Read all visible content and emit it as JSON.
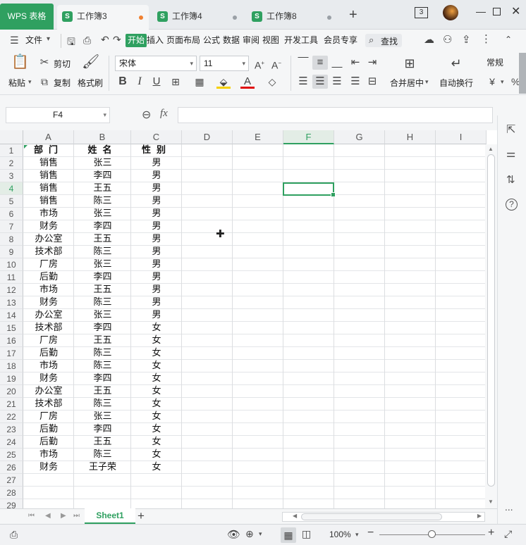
{
  "app": {
    "badge": "WPS 表格"
  },
  "tabs": [
    {
      "label": "工作簿3",
      "active": true,
      "dot_color": "#f08030"
    },
    {
      "label": "工作簿4",
      "active": false,
      "dot_color": "#9aa0a6"
    },
    {
      "label": "工作簿8",
      "active": false,
      "dot_color": "#9aa0a6"
    }
  ],
  "window": {
    "counter": "3"
  },
  "menu": {
    "file": "文件",
    "items": [
      "开始",
      "插入",
      "页面布局",
      "公式",
      "数据",
      "审阅",
      "视图",
      "开发工具",
      "会员专享"
    ],
    "active": "开始",
    "search": "查找"
  },
  "ribbon": {
    "paste": "粘贴",
    "cut": "剪切",
    "copy": "复制",
    "format_painter": "格式刷",
    "font_name": "宋体",
    "font_size": "11",
    "merge_center": "合并居中",
    "auto_wrap": "自动换行",
    "number_format": "常规",
    "currency": "¥"
  },
  "formula_bar": {
    "name_box": "F4",
    "fx": "fx",
    "formula": ""
  },
  "columns": [
    "A",
    "B",
    "C",
    "D",
    "E",
    "F",
    "G",
    "H",
    "I"
  ],
  "selected_column": "F",
  "selected_row": 4,
  "rows": [
    1,
    2,
    3,
    4,
    5,
    6,
    7,
    8,
    9,
    10,
    11,
    12,
    13,
    14,
    15,
    16,
    17,
    18,
    19,
    20,
    21,
    22,
    23,
    24,
    25,
    26,
    27,
    28,
    29
  ],
  "table": {
    "headers": [
      "部门",
      "姓名",
      "性别"
    ],
    "data": [
      [
        "销售",
        "张三",
        "男"
      ],
      [
        "销售",
        "李四",
        "男"
      ],
      [
        "销售",
        "王五",
        "男"
      ],
      [
        "销售",
        "陈三",
        "男"
      ],
      [
        "市场",
        "张三",
        "男"
      ],
      [
        "财务",
        "李四",
        "男"
      ],
      [
        "办公室",
        "王五",
        "男"
      ],
      [
        "技术部",
        "陈三",
        "男"
      ],
      [
        "厂房",
        "张三",
        "男"
      ],
      [
        "后勤",
        "李四",
        "男"
      ],
      [
        "市场",
        "王五",
        "男"
      ],
      [
        "财务",
        "陈三",
        "男"
      ],
      [
        "办公室",
        "张三",
        "男"
      ],
      [
        "技术部",
        "李四",
        "女"
      ],
      [
        "厂房",
        "王五",
        "女"
      ],
      [
        "后勤",
        "陈三",
        "女"
      ],
      [
        "市场",
        "陈三",
        "女"
      ],
      [
        "财务",
        "李四",
        "女"
      ],
      [
        "办公室",
        "王五",
        "女"
      ],
      [
        "技术部",
        "陈三",
        "女"
      ],
      [
        "厂房",
        "张三",
        "女"
      ],
      [
        "后勤",
        "李四",
        "女"
      ],
      [
        "后勤",
        "王五",
        "女"
      ],
      [
        "市场",
        "陈三",
        "女"
      ],
      [
        "财务",
        "王子荣",
        "女"
      ]
    ]
  },
  "sheets": [
    {
      "name": "Sheet1",
      "active": true
    }
  ],
  "status": {
    "zoom": "100%"
  },
  "colors": {
    "accent": "#2fa060"
  }
}
